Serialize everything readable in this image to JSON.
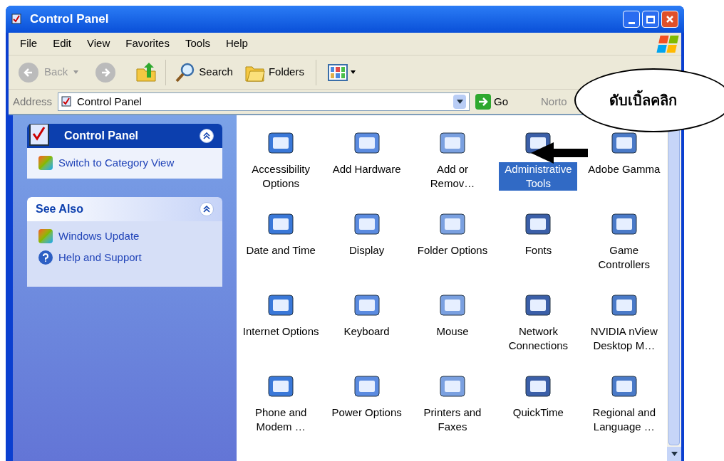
{
  "window": {
    "title": "Control Panel"
  },
  "menu": [
    "File",
    "Edit",
    "View",
    "Favorites",
    "Tools",
    "Help"
  ],
  "toolbar": {
    "back": "Back",
    "search": "Search",
    "folders": "Folders"
  },
  "address": {
    "label": "Address",
    "value": "Control Panel",
    "go": "Go",
    "links": "Norto"
  },
  "tasks": [
    {
      "title": "Control Panel",
      "kind": "primary",
      "items": [
        "Switch to Category View"
      ]
    },
    {
      "title": "See Also",
      "kind": "secondary",
      "items": [
        "Windows Update",
        "Help and Support"
      ]
    }
  ],
  "applets": [
    {
      "label": "Accessibility Options",
      "selected": false
    },
    {
      "label": "Add Hardware",
      "selected": false
    },
    {
      "label": "Add or Remov…",
      "selected": false
    },
    {
      "label": "Administrative Tools",
      "selected": true
    },
    {
      "label": "Adobe Gamma",
      "selected": false
    },
    {
      "label": "Date and Time",
      "selected": false
    },
    {
      "label": "Display",
      "selected": false
    },
    {
      "label": "Folder Options",
      "selected": false
    },
    {
      "label": "Fonts",
      "selected": false
    },
    {
      "label": "Game Controllers",
      "selected": false
    },
    {
      "label": "Internet Options",
      "selected": false
    },
    {
      "label": "Keyboard",
      "selected": false
    },
    {
      "label": "Mouse",
      "selected": false
    },
    {
      "label": "Network Connections",
      "selected": false
    },
    {
      "label": "NVIDIA nView Desktop M…",
      "selected": false
    },
    {
      "label": "Phone and Modem …",
      "selected": false
    },
    {
      "label": "Power Options",
      "selected": false
    },
    {
      "label": "Printers and Faxes",
      "selected": false
    },
    {
      "label": "QuickTime",
      "selected": false
    },
    {
      "label": "Regional and Language …",
      "selected": false
    }
  ],
  "callout": {
    "text": "ดับเบิ้ลคลิก"
  }
}
